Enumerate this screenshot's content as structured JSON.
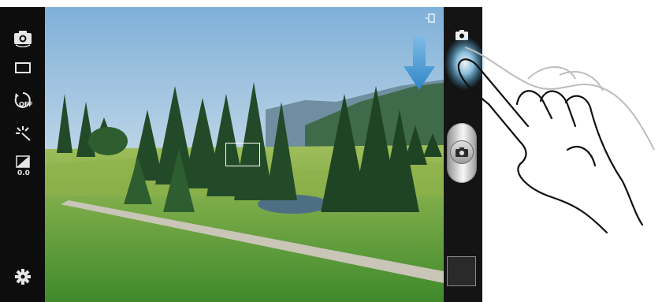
{
  "left_bar": {
    "items": [
      {
        "icon": "self-shot-icon"
      },
      {
        "icon": "aspect-ratio-icon"
      },
      {
        "icon": "timer-off-icon",
        "label": "OFF"
      },
      {
        "icon": "flash-icon"
      },
      {
        "icon": "exposure-icon",
        "label": "0.0"
      },
      {
        "icon": "settings-gear-icon"
      }
    ]
  },
  "right_bar": {
    "mode_icon": "camera-mode-icon",
    "shutter_icon": "camera-icon",
    "thumbnail": "last-photo-thumbnail"
  },
  "colors": {
    "bar_background": "#0d0d0d",
    "arrow": "#2f86c8",
    "hand_glow": "#3aa7e6"
  }
}
